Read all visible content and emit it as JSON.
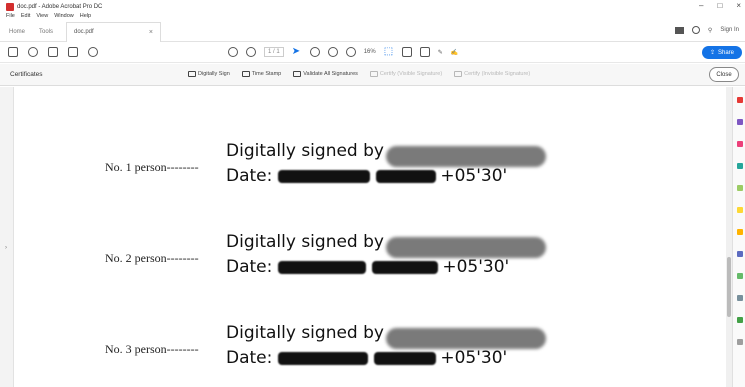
{
  "window": {
    "title": "doc.pdf - Adobe Acrobat Pro DC",
    "controls": [
      "–",
      "□",
      "×"
    ]
  },
  "menu": [
    "File",
    "Edit",
    "View",
    "Window",
    "Help"
  ],
  "tabs": {
    "home": "Home",
    "tools": "Tools",
    "document": "doc.pdf",
    "sign_in": "Sign In"
  },
  "toolbar": {
    "page_current": "1",
    "page_total": "/ 1",
    "zoom": "16%",
    "share_label": "Share"
  },
  "certificates_bar": {
    "title": "Certificates",
    "tools": [
      {
        "label": "Digitally Sign",
        "enabled": true,
        "icon": "pen-sign-icon"
      },
      {
        "label": "Time Stamp",
        "enabled": true,
        "icon": "clock-doc-icon"
      },
      {
        "label": "Validate All Signatures",
        "enabled": true,
        "icon": "validate-pen-icon"
      },
      {
        "label": "Certify (Visible Signature)",
        "enabled": false,
        "icon": "certify-visible-icon"
      },
      {
        "label": "Certify (Invisible Signature)",
        "enabled": false,
        "icon": "certify-invisible-icon"
      }
    ],
    "close_label": "Close"
  },
  "signatures": [
    {
      "person_label": "No. 1 person--------",
      "signed_by_label": "Digitally signed by",
      "date_label": "Date:",
      "tz": "+05'30'"
    },
    {
      "person_label": "No. 2 person--------",
      "signed_by_label": "Digitally signed by",
      "date_label": "Date:",
      "tz": "+05'30'"
    },
    {
      "person_label": "No. 3 person--------",
      "signed_by_label": "Digitally signed by",
      "date_label": "Date:",
      "tz": "+05'30'"
    }
  ],
  "colors": {
    "accent": "#1473e6",
    "redaction": "#111111",
    "blurred_name": "#7a7a7a"
  }
}
